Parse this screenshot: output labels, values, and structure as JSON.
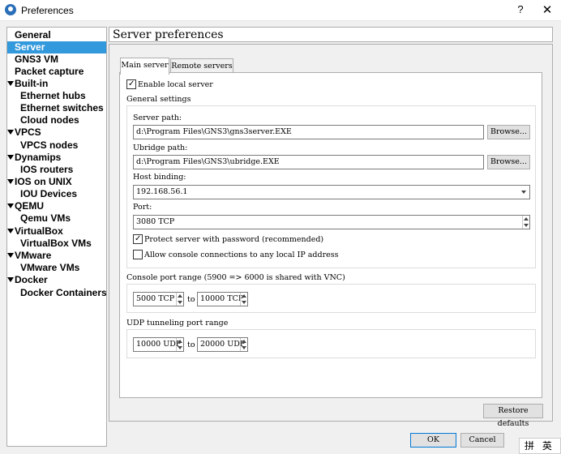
{
  "window": {
    "title": "Preferences",
    "help": "?",
    "close": "✕"
  },
  "sidebar": {
    "items": [
      {
        "label": "General"
      },
      {
        "label": "Server"
      },
      {
        "label": "GNS3 VM"
      },
      {
        "label": "Packet capture"
      },
      {
        "label": "Built-in"
      },
      {
        "label": "Ethernet hubs"
      },
      {
        "label": "Ethernet switches"
      },
      {
        "label": "Cloud nodes"
      },
      {
        "label": "VPCS"
      },
      {
        "label": "VPCS nodes"
      },
      {
        "label": "Dynamips"
      },
      {
        "label": "IOS routers"
      },
      {
        "label": "IOS on UNIX"
      },
      {
        "label": "IOU Devices"
      },
      {
        "label": "QEMU"
      },
      {
        "label": "Qemu VMs"
      },
      {
        "label": "VirtualBox"
      },
      {
        "label": "VirtualBox VMs"
      },
      {
        "label": "VMware"
      },
      {
        "label": "VMware VMs"
      },
      {
        "label": "Docker"
      },
      {
        "label": "Docker Containers"
      }
    ],
    "selected": "Server"
  },
  "pane": {
    "title": "Server preferences"
  },
  "tabs": [
    {
      "label": "Main server",
      "active": true
    },
    {
      "label": "Remote servers",
      "active": false
    }
  ],
  "main": {
    "enable_local_server": {
      "label": "Enable local server",
      "checked": true
    },
    "general_settings": "General settings",
    "server_path": {
      "label": "Server path:",
      "value": "d:\\Program Files\\GNS3\\gns3server.EXE",
      "browse": "Browse..."
    },
    "ubridge_path": {
      "label": "Ubridge path:",
      "value": "d:\\Program Files\\GNS3\\ubridge.EXE",
      "browse": "Browse..."
    },
    "host_binding": {
      "label": "Host binding:",
      "value": "192.168.56.1"
    },
    "port": {
      "label": "Port:",
      "value": "3080 TCP"
    },
    "protect_password": {
      "label": "Protect server with password (recommended)",
      "checked": true
    },
    "allow_console": {
      "label": "Allow console connections to any local IP address",
      "checked": false
    },
    "console_range": {
      "label": "Console port range (5900 => 6000 is shared with VNC)",
      "from": "5000 TCP",
      "to_label": "to",
      "to": "10000 TCP"
    },
    "udp_range": {
      "label": "UDP tunneling port range",
      "from": "10000 UDP",
      "to_label": "to",
      "to": "20000 UDP"
    },
    "restore_defaults": "Restore defaults"
  },
  "footer": {
    "ok": "OK",
    "cancel": "Cancel"
  },
  "ime": {
    "text": "拼 英 ♪"
  }
}
